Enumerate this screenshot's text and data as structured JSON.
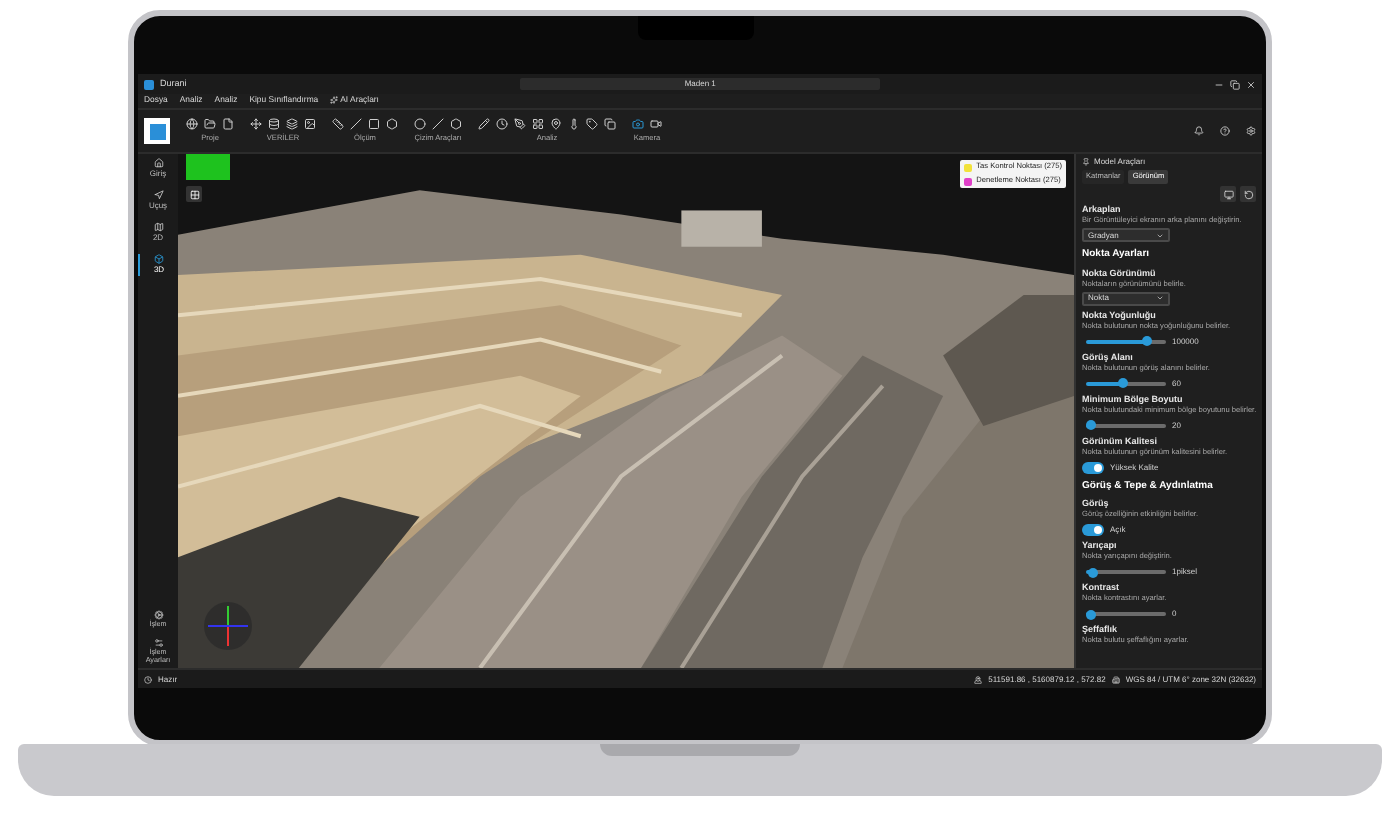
{
  "window": {
    "app_name": "Durani",
    "document": "Maden 1"
  },
  "menu": [
    "Dosya",
    "Analiz",
    "Analiz",
    "Kipu Sınıflandırma",
    "AI Araçları"
  ],
  "toolbar_groups": [
    "Proje",
    "VERİLER",
    "Ölçüm",
    "Çizim Araçları",
    "Analiz",
    "Kamera"
  ],
  "sidebar": [
    {
      "label": "Giriş",
      "selected": false
    },
    {
      "label": "Uçuş",
      "selected": false
    },
    {
      "label": "2D",
      "selected": false
    },
    {
      "label": "3D",
      "selected": true
    }
  ],
  "sidebar_bottom": [
    "İşlem",
    "İşlem Ayarları"
  ],
  "legend": [
    {
      "label": "Tas Kontrol Noktası (275)",
      "color": "#f2e23a"
    },
    {
      "label": "Denetleme Noktası (275)",
      "color": "#e040c8"
    }
  ],
  "panel": {
    "title": "Model Araçları",
    "tabs": [
      {
        "label": "Katmanlar",
        "selected": false
      },
      {
        "label": "Görünüm",
        "selected": true
      }
    ],
    "items": [
      {
        "kind": "field",
        "title": "Arkaplan",
        "description": "Bir Görüntüleyici ekranın arka planını değiştirin."
      },
      {
        "kind": "select",
        "value": "Gradyan"
      },
      {
        "kind": "heading",
        "title": "Nokta Ayarları"
      },
      {
        "kind": "field",
        "title": "Nokta Görünümü",
        "description": "Noktaların görünümünü belirle."
      },
      {
        "kind": "select",
        "value": "Nokta"
      },
      {
        "kind": "field",
        "title": "Nokta Yoğunluğu",
        "description": "Nokta bulutunun nokta yoğunluğunu belirler."
      },
      {
        "kind": "slider",
        "level": 0.75,
        "reading": "100000"
      },
      {
        "kind": "field",
        "title": "Görüş Alanı",
        "description": "Nokta bulutunun görüş alanını belirler."
      },
      {
        "kind": "slider",
        "level": 0.45,
        "reading": "60"
      },
      {
        "kind": "field",
        "title": "Minimum Bölge Boyutu",
        "description": "Nokta bulutundaki minimum bölge boyutunu belirler."
      },
      {
        "kind": "slider",
        "level": 0.05,
        "reading": "20"
      },
      {
        "kind": "field",
        "title": "Görünüm Kalitesi",
        "description": "Nokta bulutunun görünüm kalitesini belirler."
      },
      {
        "kind": "toggle",
        "on": true,
        "label": "Yüksek Kalite"
      },
      {
        "kind": "heading",
        "title": "Görüş & Tepe & Aydınlatma"
      },
      {
        "kind": "field",
        "title": "Görüş",
        "description": "Görüş özelliğinin etkinliğini belirler."
      },
      {
        "kind": "toggle",
        "on": true,
        "label": "Açık"
      },
      {
        "kind": "field",
        "title": "Yarıçapı",
        "description": "Nokta yarıçapını değiştirin."
      },
      {
        "kind": "slider",
        "level": 0.08,
        "reading": "1piksel"
      },
      {
        "kind": "field",
        "title": "Kontrast",
        "description": "Nokta kontrastını ayarlar."
      },
      {
        "kind": "slider",
        "level": 0.06,
        "reading": "0"
      },
      {
        "kind": "field",
        "title": "Şeffaflık",
        "description": "Nokta bulutu şeffaflığını ayarlar."
      }
    ]
  },
  "status_bar": {
    "state": "Hazır",
    "coordinates": "511591.86 , 5160879.12 , 572.82",
    "crs": "WGS 84 / UTM 6° zone 32N (32632)"
  }
}
